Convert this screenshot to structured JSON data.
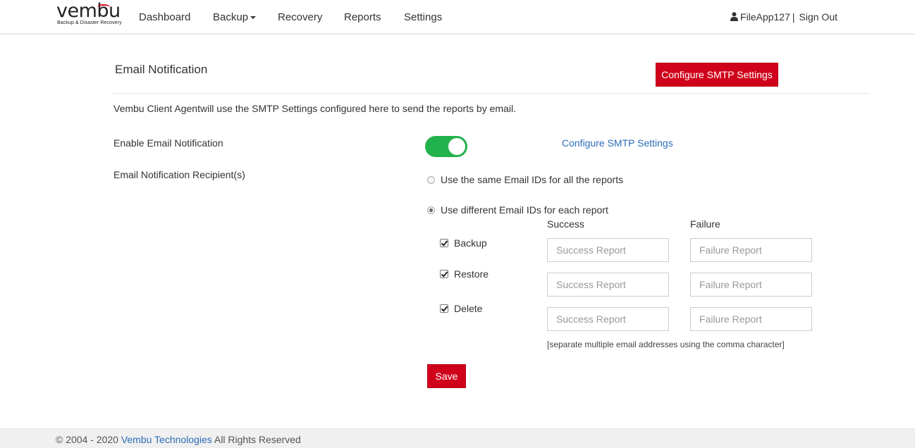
{
  "brand": {
    "name": "vembu",
    "tagline": "Backup & Disaster Recovery",
    "accent": "#d0021b"
  },
  "nav": {
    "items": [
      {
        "label": "Dashboard"
      },
      {
        "label": "Backup"
      },
      {
        "label": "Recovery"
      },
      {
        "label": "Reports"
      },
      {
        "label": "Settings"
      }
    ],
    "user": "FileApp127",
    "separator": "|",
    "signout": "Sign Out",
    "user_icon": "user-icon"
  },
  "page": {
    "title": "Email Notification",
    "configure_button": "Configure SMTP Settings",
    "intro": "Vembu Client Agentwill use the SMTP Settings configured here to send the reports by email.",
    "enable_label": "Enable Email Notification",
    "enable_on": true,
    "toggle_color": "#22b24c",
    "configure_link": "Configure SMTP Settings",
    "recipients_label": "Email Notification Recipient(s)",
    "radio_same": "Use the same Email IDs for all the reports",
    "radio_different": "Use different Email IDs for each report",
    "selected_radio": "different",
    "col_success": "Success",
    "col_failure": "Failure",
    "rows": [
      {
        "label": "Backup",
        "checked": true,
        "success_placeholder": "Success Report",
        "failure_placeholder": "Failure Report"
      },
      {
        "label": "Restore",
        "checked": true,
        "success_placeholder": "Success Report",
        "failure_placeholder": "Failure Report"
      },
      {
        "label": "Delete",
        "checked": true,
        "success_placeholder": "Success Report",
        "failure_placeholder": "Failure Report"
      }
    ],
    "hint": "[separate multiple email addresses using the comma character]",
    "save_button": "Save"
  },
  "footer": {
    "prefix": "© 2004 - 2020",
    "company": "Vembu Technologies",
    "suffix": "All Rights Reserved",
    "link_color": "#2c6db8"
  }
}
